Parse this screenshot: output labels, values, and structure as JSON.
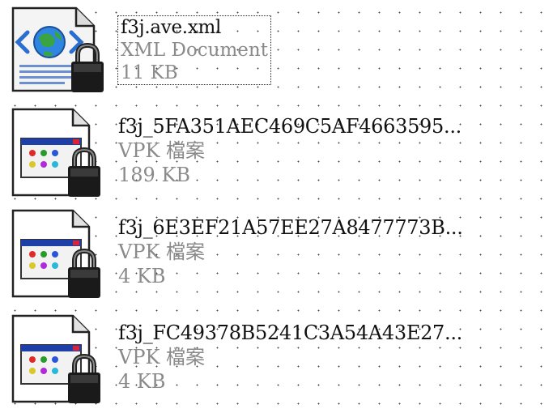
{
  "files": [
    {
      "name": "f3j.ave.xml",
      "type": "XML Document",
      "size": "11 KB",
      "icon": "xml-document-locked-icon"
    },
    {
      "name": "f3j_5FA351AEC469C5AF4663595...",
      "type": "VPK 檔案",
      "size": "189 KB",
      "icon": "vpk-file-locked-icon"
    },
    {
      "name": "f3j_6E3EF21A57EE27A8477773B...",
      "type": "VPK 檔案",
      "size": "4 KB",
      "icon": "vpk-file-locked-icon"
    },
    {
      "name": "f3j_FC49378B5241C3A54A43E27...",
      "type": "VPK 檔案",
      "size": "4 KB",
      "icon": "vpk-file-locked-icon"
    }
  ]
}
